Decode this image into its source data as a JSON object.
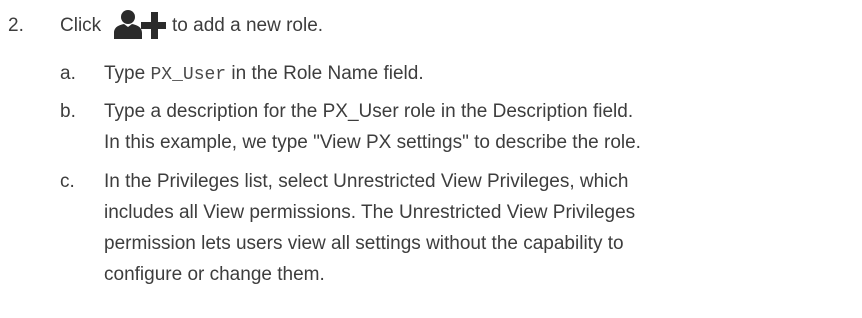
{
  "step": {
    "number": "2.",
    "text_before_icon": "Click",
    "icon": "add-user-icon",
    "text_after_icon": "to add a new role."
  },
  "substeps": [
    {
      "letter": "a.",
      "before_code": "Type",
      "code": "PX_User",
      "after_code": "in the Role Name field."
    },
    {
      "letter": "b.",
      "lines": [
        "Type a description for the PX_User role in the Description field.",
        "In this example, we type \"View PX settings\" to describe the role."
      ]
    },
    {
      "letter": "c.",
      "lines": [
        "In the Privileges list, select Unrestricted View Privileges, which",
        "includes all View permissions. The Unrestricted View Privileges",
        "permission lets users view all settings without the capability to",
        "configure or change them."
      ]
    }
  ],
  "colors": {
    "text": "#3d3d3d",
    "icon": "#2b2b2b"
  }
}
